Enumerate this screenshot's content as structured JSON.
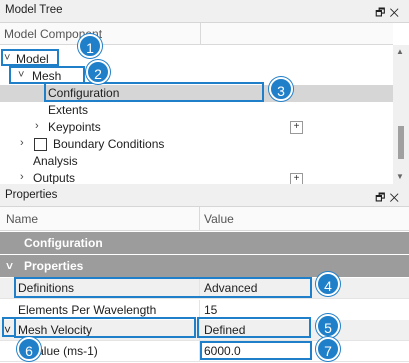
{
  "model_tree": {
    "title": "Model Tree",
    "pin_icon": "pin-icon",
    "close_icon": "close-icon",
    "column_header": "Model Component",
    "items": [
      {
        "label": "Model",
        "expander": "˅"
      },
      {
        "label": "Mesh",
        "expander": "˅"
      },
      {
        "label": "Configuration"
      },
      {
        "label": "Extents"
      },
      {
        "label": "Keypoints",
        "expander": "›",
        "action": "+"
      },
      {
        "label": "Boundary Conditions",
        "expander": "›"
      },
      {
        "label": "Analysis"
      },
      {
        "label": "Outputs",
        "expander": "›",
        "action": "+"
      }
    ]
  },
  "properties": {
    "title": "Properties",
    "pin_icon": "pin-icon",
    "close_icon": "close-icon",
    "col_name": "Name",
    "col_value": "Value",
    "categories": [
      {
        "label": "Configuration"
      },
      {
        "label": "Properties",
        "expander": "˅"
      }
    ],
    "rows": [
      {
        "name": "Definitions",
        "value": "Advanced"
      },
      {
        "name": "Elements Per Wavelength",
        "value": "15"
      },
      {
        "name": "Mesh Velocity",
        "value": "Defined",
        "expander": "˅"
      },
      {
        "name": "Value (ms-1)",
        "value": "6000.0"
      }
    ]
  },
  "callouts": [
    "1",
    "2",
    "3",
    "4",
    "5",
    "6",
    "7"
  ],
  "colors": {
    "accent": "#1f7fc9",
    "category_bg": "#9c9c9c",
    "selected_row": "#d6d6d6"
  }
}
